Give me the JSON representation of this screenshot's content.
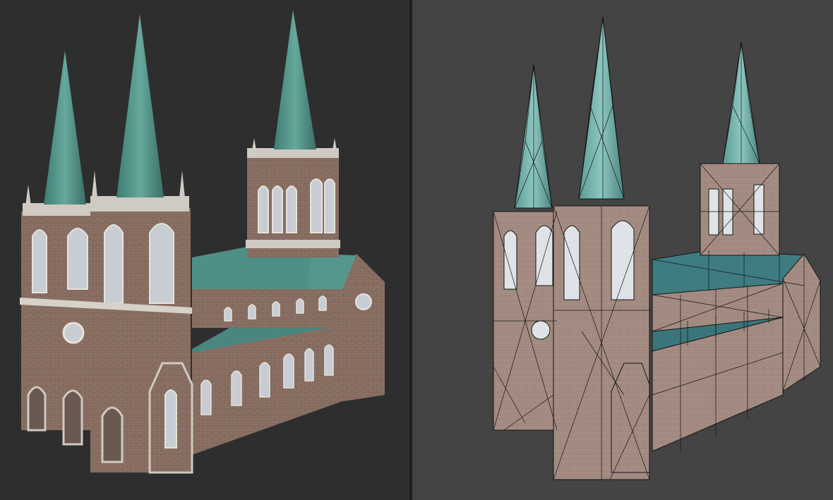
{
  "viewports": [
    {
      "mode": "textured",
      "icon": "church-model-icon"
    },
    {
      "mode": "wireframe",
      "icon": "church-model-icon"
    }
  ],
  "colors": {
    "left_background": "#2e2e2e",
    "right_background": "#444444",
    "divider": "#1f1f1f",
    "brick": "#8a6f62",
    "brick_dark": "#6f574c",
    "stone_trim": "#c9c4bc",
    "copper_roof": "#4f8f86",
    "copper_light": "#6fb0a4",
    "glass": "#c8cdd4",
    "wire": "#141414"
  }
}
